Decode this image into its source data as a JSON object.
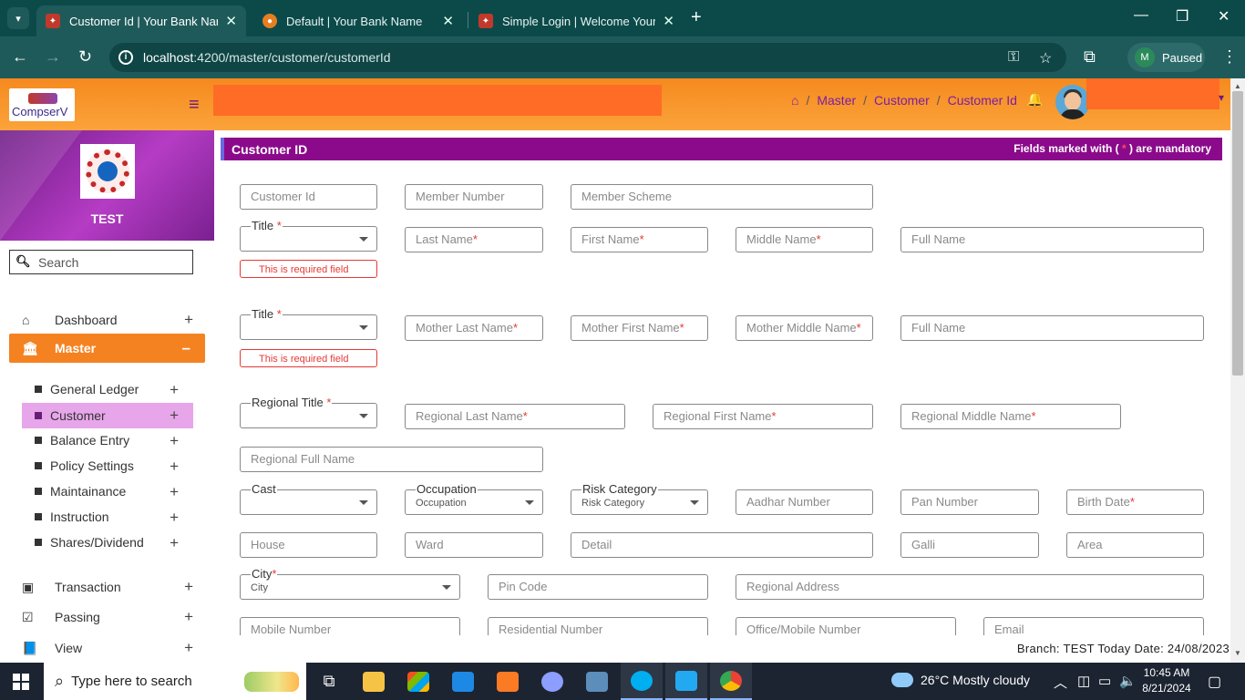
{
  "browser": {
    "tabs": [
      {
        "title": "Customer Id | Your Bank Name",
        "active": true
      },
      {
        "title": "Default | Your Bank Name",
        "active": false
      },
      {
        "title": "Simple Login | Welcome Your B",
        "active": false
      }
    ],
    "url_host": "localhost",
    "url_path": ":4200/master/customer/customerId",
    "profile_initial": "M",
    "profile_status": "Paused"
  },
  "header": {
    "logo_text": "CompserV",
    "breadcrumb": [
      "Master",
      "Customer",
      "Customer Id"
    ]
  },
  "sidebar": {
    "brand": "TEST",
    "search_placeholder": "Search",
    "items": [
      {
        "label": "Dashboard"
      },
      {
        "label": "Master"
      },
      {
        "label": "Transaction"
      },
      {
        "label": "Passing"
      },
      {
        "label": "View"
      }
    ],
    "master_sub": [
      {
        "label": "General Ledger"
      },
      {
        "label": "Customer"
      },
      {
        "label": "Balance Entry"
      },
      {
        "label": "Policy Settings"
      },
      {
        "label": "Maintainance"
      },
      {
        "label": "Instruction"
      },
      {
        "label": "Shares/Dividend"
      }
    ]
  },
  "form": {
    "title": "Customer ID",
    "mandatory_note_pre": "Fields marked with (",
    "mandatory_star": " * ",
    "mandatory_note_post": ") are mandatory",
    "error_text": "This is required field",
    "customer_id": "Customer Id",
    "member_number": "Member Number",
    "member_scheme": "Member Scheme",
    "title_label": "Title",
    "last_name": "Last Name",
    "first_name": "First Name",
    "middle_name": "Middle Name",
    "full_name": "Full Name",
    "mother_last_name": "Mother Last Name",
    "mother_first_name": "Mother First Name",
    "mother_middle_name": "Mother Middle Name",
    "regional_title": "Regional Title",
    "regional_last_name": "Regional Last Name",
    "regional_first_name": "Regional First Name",
    "regional_middle_name": "Regional Middle Name",
    "regional_full_name": "Regional Full Name",
    "cast": "Cast",
    "occupation": "Occupation",
    "risk_category": "Risk Category",
    "aadhar": "Aadhar Number",
    "pan": "Pan Number",
    "birth_date": "Birth Date",
    "house": "House",
    "ward": "Ward",
    "detail": "Detail",
    "galli": "Galli",
    "area": "Area",
    "city": "City",
    "pin_code": "Pin Code",
    "regional_address": "Regional Address",
    "mobile": "Mobile Number",
    "residential": "Residential Number",
    "office_mobile": "Office/Mobile Number",
    "email": "Email",
    "required_mark": "*"
  },
  "status": {
    "text": "Branch: TEST Today Date: 24/08/2023"
  },
  "taskbar": {
    "search_placeholder": "Type here to search",
    "weather": "26°C  Mostly cloudy",
    "time": "10:45 AM",
    "date": "8/21/2024"
  }
}
